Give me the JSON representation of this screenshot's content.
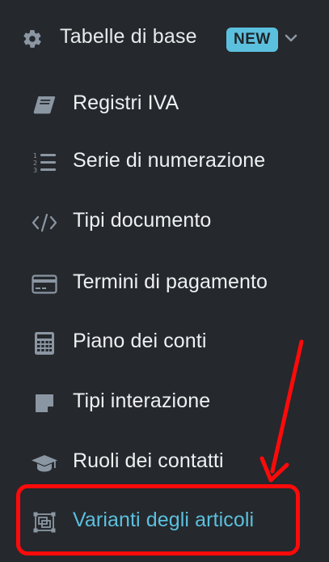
{
  "section": {
    "title": "Tabelle di base",
    "badge": "NEW",
    "icon": "gear-icon",
    "chevron": "chevron-down-icon"
  },
  "menu": {
    "items": [
      {
        "label": "Registri IVA",
        "icon": "book-icon"
      },
      {
        "label": "Serie di numerazione",
        "icon": "numbered-list-icon"
      },
      {
        "label": "Tipi documento",
        "icon": "code-icon"
      },
      {
        "label": "Termini di pagamento",
        "icon": "credit-card-icon"
      },
      {
        "label": "Piano dei conti",
        "icon": "calculator-icon"
      },
      {
        "label": "Tipi interazione",
        "icon": "sticky-note-icon"
      },
      {
        "label": "Ruoli dei contatti",
        "icon": "graduation-cap-icon"
      },
      {
        "label": "Varianti degli articoli",
        "icon": "object-group-icon",
        "active": true
      }
    ]
  },
  "colors": {
    "background": "#25282c",
    "text": "#eef0f2",
    "accent": "#5bc0de",
    "icon": "#8b96a3",
    "annotation": "#ff0a0a"
  }
}
